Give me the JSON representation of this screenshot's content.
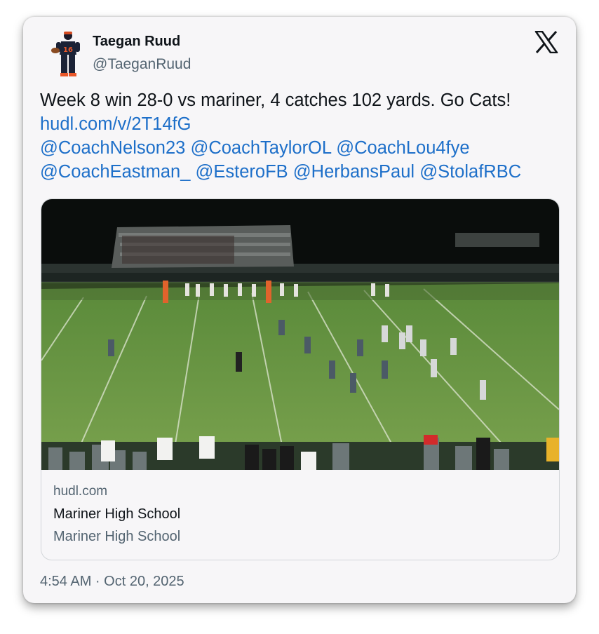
{
  "author": {
    "name": "Taegan Ruud",
    "handle": "@TaeganRuud"
  },
  "tweet": {
    "text": "Week 8 win 28-0 vs mariner, 4 catches 102 yards. Go Cats!",
    "link": "hudl.com/v/2T14fG",
    "mentions_line1": [
      "@CoachNelson23",
      "@CoachTaylorOL",
      "@CoachLou4fye"
    ],
    "mentions_line2": [
      "@CoachEastman_",
      "@EsteroFB",
      "@HerbansPaul",
      "@StolafRBC"
    ],
    "m1": "@CoachNelson23",
    "m2": "@CoachTaylorOL",
    "m3": "@CoachLou4fye",
    "m4": "@CoachEastman_",
    "m5": "@EsteroFB",
    "m6": "@HerbansPaul",
    "m7": "@StolafRBC"
  },
  "link_card": {
    "domain": "hudl.com",
    "title": "Mariner High School",
    "description": "Mariner High School",
    "media": "football game night scene"
  },
  "timestamp": "4:54 AM · Oct 20, 2025",
  "icons": {
    "platform": "x-logo-icon",
    "avatar": "football-player-avatar"
  },
  "colors": {
    "link": "#1d6fc9",
    "secondary_text": "#536471",
    "card_bg": "#f7f6f8"
  }
}
